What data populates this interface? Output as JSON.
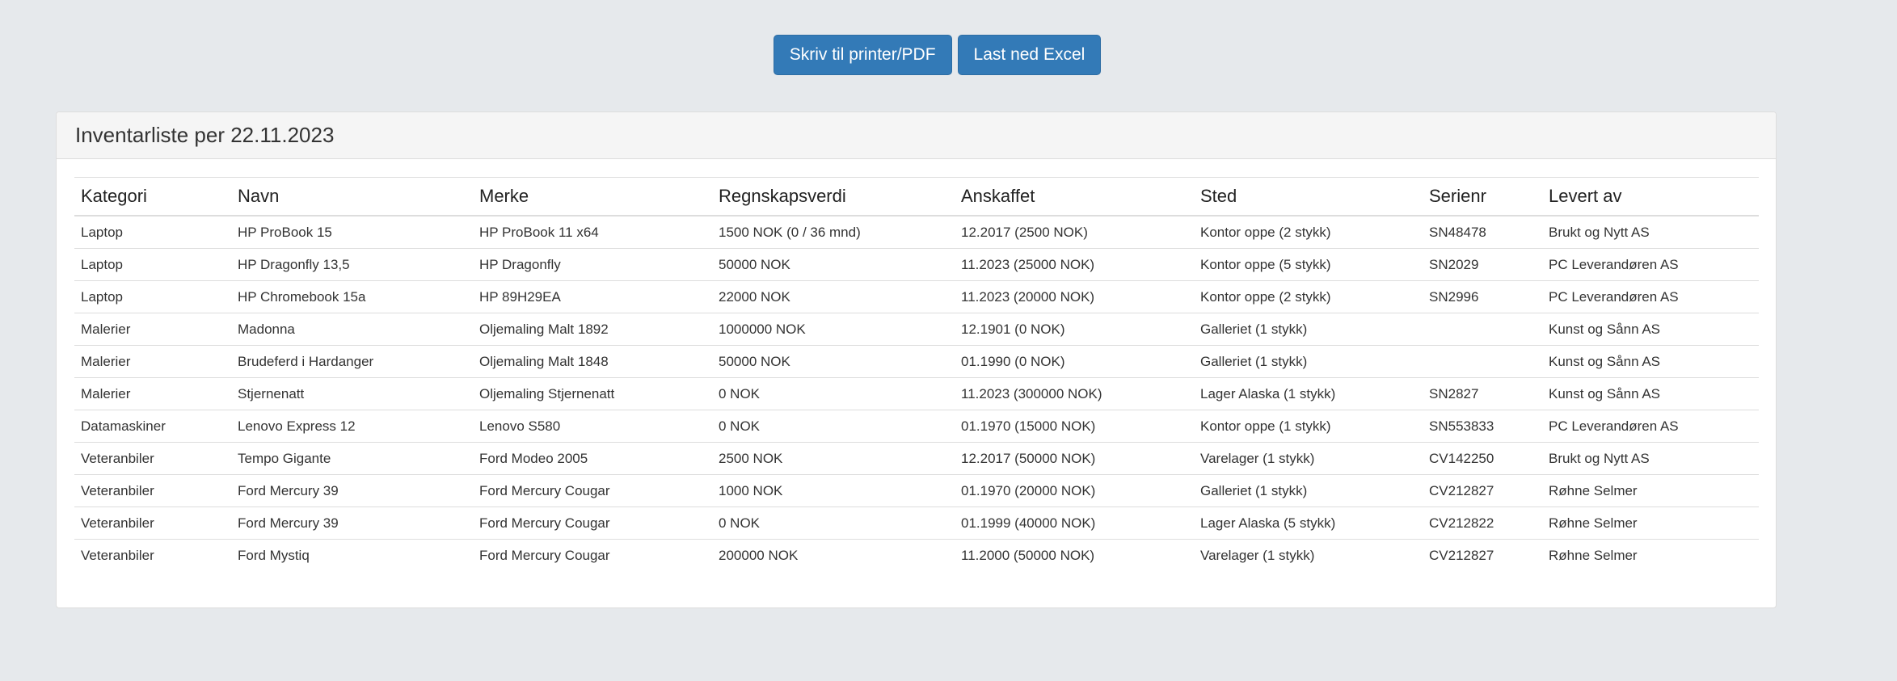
{
  "toolbar": {
    "print_label": "Skriv til printer/PDF",
    "excel_label": "Last ned Excel"
  },
  "panel": {
    "title": "Inventarliste per 22.11.2023"
  },
  "table": {
    "headers": [
      "Kategori",
      "Navn",
      "Merke",
      "Regnskapsverdi",
      "Anskaffet",
      "Sted",
      "Serienr",
      "Levert av"
    ],
    "rows": [
      [
        "Laptop",
        "HP ProBook 15",
        "HP ProBook 11 x64",
        "1500 NOK (0 / 36 mnd)",
        "12.2017 (2500 NOK)",
        "Kontor oppe (2 stykk)",
        "SN48478",
        "Brukt og Nytt AS"
      ],
      [
        "Laptop",
        "HP Dragonfly 13,5",
        "HP Dragonfly",
        "50000 NOK",
        "11.2023 (25000 NOK)",
        "Kontor oppe (5 stykk)",
        "SN2029",
        "PC Leverandøren AS"
      ],
      [
        "Laptop",
        "HP Chromebook 15a",
        "HP 89H29EA",
        "22000 NOK",
        "11.2023 (20000 NOK)",
        "Kontor oppe (2 stykk)",
        "SN2996",
        "PC Leverandøren AS"
      ],
      [
        "Malerier",
        "Madonna",
        "Oljemaling Malt 1892",
        "1000000 NOK",
        "12.1901 (0 NOK)",
        "Galleriet (1 stykk)",
        "",
        "Kunst og Sånn AS"
      ],
      [
        "Malerier",
        "Brudeferd i Hardanger",
        "Oljemaling Malt 1848",
        "50000 NOK",
        "01.1990 (0 NOK)",
        "Galleriet (1 stykk)",
        "",
        "Kunst og Sånn AS"
      ],
      [
        "Malerier",
        "Stjernenatt",
        "Oljemaling Stjernenatt",
        "0 NOK",
        "11.2023 (300000 NOK)",
        "Lager Alaska (1 stykk)",
        "SN2827",
        "Kunst og Sånn AS"
      ],
      [
        "Datamaskiner",
        "Lenovo Express 12",
        "Lenovo S580",
        "0 NOK",
        "01.1970 (15000 NOK)",
        "Kontor oppe (1 stykk)",
        "SN553833",
        "PC Leverandøren AS"
      ],
      [
        "Veteranbiler",
        "Tempo Gigante",
        "Ford Modeo 2005",
        "2500 NOK",
        "12.2017 (50000 NOK)",
        "Varelager (1 stykk)",
        "CV142250",
        "Brukt og Nytt AS"
      ],
      [
        "Veteranbiler",
        "Ford Mercury 39",
        "Ford Mercury Cougar",
        "1000 NOK",
        "01.1970 (20000 NOK)",
        "Galleriet (1 stykk)",
        "CV212827",
        "Røhne Selmer"
      ],
      [
        "Veteranbiler",
        "Ford Mercury 39",
        "Ford Mercury Cougar",
        "0 NOK",
        "01.1999 (40000 NOK)",
        "Lager Alaska (5 stykk)",
        "CV212822",
        "Røhne Selmer"
      ],
      [
        "Veteranbiler",
        "Ford Mystiq",
        "Ford Mercury Cougar",
        "200000 NOK",
        "11.2000 (50000 NOK)",
        "Varelager (1 stykk)",
        "CV212827",
        "Røhne Selmer"
      ]
    ]
  },
  "colors": {
    "page_background": "#e6e9ec",
    "button_primary": "#337ab7",
    "panel_heading": "#f5f5f5"
  }
}
